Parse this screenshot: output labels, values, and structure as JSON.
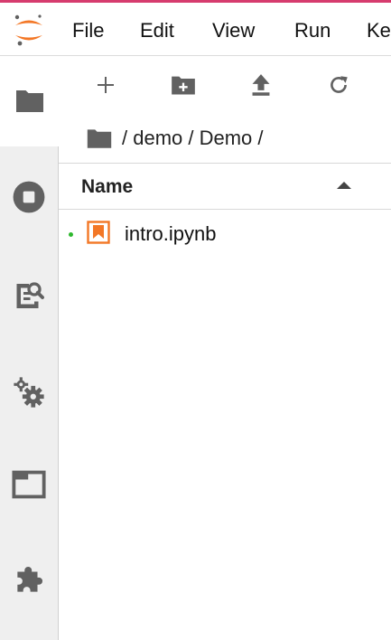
{
  "menubar": {
    "items": [
      "File",
      "Edit",
      "View",
      "Run",
      "Ke"
    ]
  },
  "breadcrumb": {
    "path": "/ demo / Demo /"
  },
  "file_list": {
    "column_name": "Name",
    "files": [
      {
        "name": "intro.ipynb",
        "status": "running"
      }
    ]
  },
  "colors": {
    "accent": "#f37726",
    "running_dot": "#2eb82e",
    "icon_gray": "#616161",
    "top_border": "#d63b6e"
  }
}
